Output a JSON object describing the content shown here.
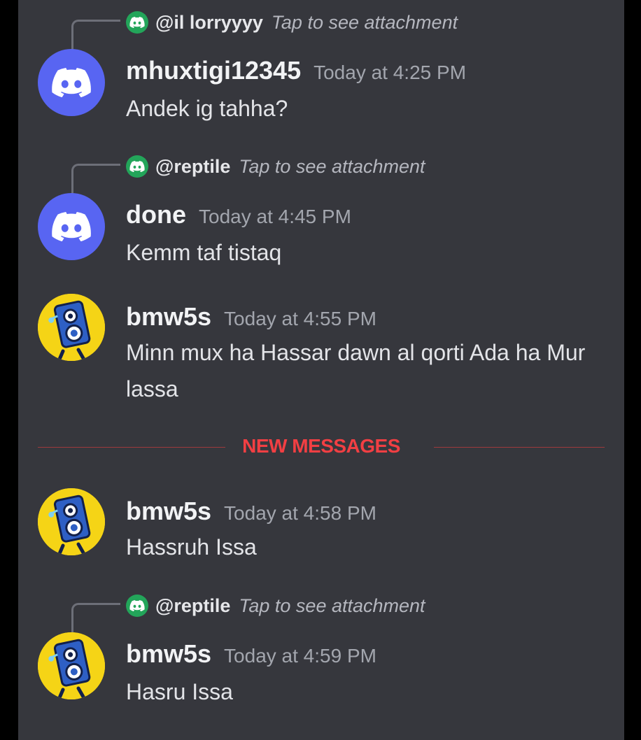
{
  "messages": [
    {
      "reply": {
        "user": "@il lorryyyy",
        "hint": "Tap to see attachment",
        "avatar_icon": "discord-logo-icon"
      },
      "author": "mhuxtigi12345",
      "timestamp": "Today at 4:25 PM",
      "text": "Andek ig tahha?",
      "avatar_icon": "discord-logo-icon"
    },
    {
      "reply": {
        "user": "@reptile",
        "hint": "Tap to see attachment",
        "avatar_icon": "discord-logo-icon"
      },
      "author": "done",
      "timestamp": "Today at 4:45 PM",
      "text": "Kemm taf tistaq",
      "avatar_icon": "discord-logo-icon"
    },
    {
      "author": "bmw5s",
      "timestamp": "Today at 4:55 PM",
      "text": "Minn mux ha Hassar dawn al qorti Ada ha Mur lassa",
      "avatar_icon": "speaker-character-icon"
    },
    {
      "author": "bmw5s",
      "timestamp": "Today at 4:58 PM",
      "text": "Hassruh Issa",
      "avatar_icon": "speaker-character-icon"
    },
    {
      "reply": {
        "user": "@reptile",
        "hint": "Tap to see attachment",
        "avatar_icon": "discord-logo-icon"
      },
      "author": "bmw5s",
      "timestamp": "Today at 4:59 PM",
      "text": "Hasru Issa",
      "avatar_icon": "speaker-character-icon"
    }
  ],
  "divider": {
    "label": "NEW MESSAGES"
  },
  "colors": {
    "background": "#36373d",
    "discord_blurple": "#5865f2",
    "reply_avatar_green": "#23a55a",
    "new_messages_red": "#f23f43",
    "bmw_avatar_yellow": "#f5d416"
  }
}
